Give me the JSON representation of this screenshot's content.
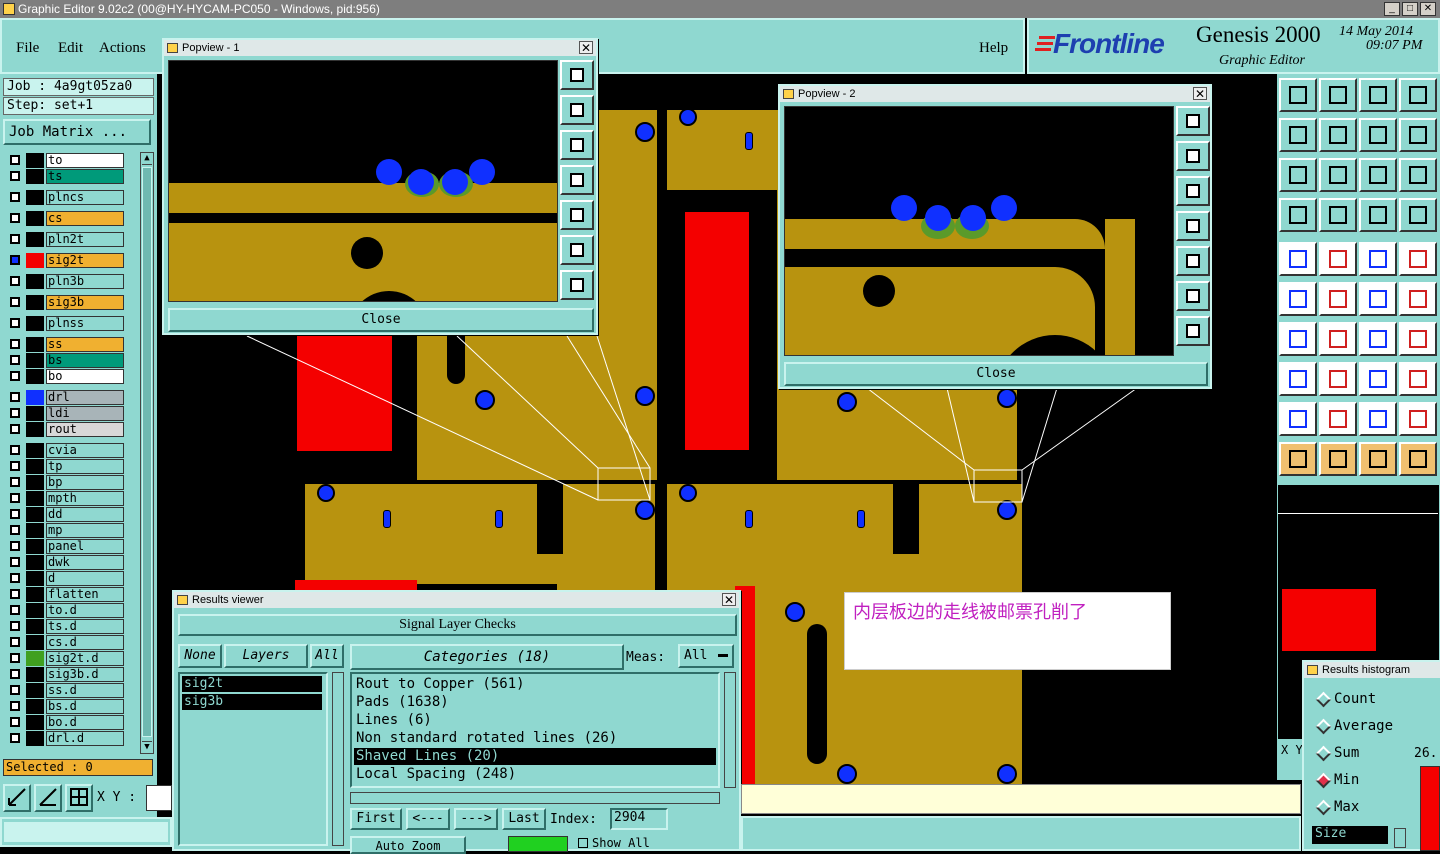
{
  "window": {
    "title": "Graphic Editor 9.02c2 (00@HY-HYCAM-PC050 - Windows, pid:956)"
  },
  "menu": {
    "file": "File",
    "edit": "Edit",
    "actions": "Actions",
    "help": "Help"
  },
  "brand": {
    "logo": "Frontline",
    "product": "Genesis 2000",
    "subtitle": "Graphic Editor",
    "date": "14 May 2014",
    "time": "09:07 PM"
  },
  "job": {
    "job_label": "Job : 4a9gt05za0",
    "step_label": "Step: set+1",
    "matrix_button": "Job Matrix ..."
  },
  "layers": [
    {
      "name": "to",
      "color": "#ffffff"
    },
    {
      "name": "ts",
      "color": "#009a7a"
    },
    {
      "name": "plncs",
      "color": "#8fd8d0"
    },
    {
      "name": "cs",
      "color": "#f0b030"
    },
    {
      "name": "pln2t",
      "color": "#8fd8d0"
    },
    {
      "name": "sig2t",
      "color": "#f0b030"
    },
    {
      "name": "pln3b",
      "color": "#8fd8d0"
    },
    {
      "name": "sig3b",
      "color": "#f0b030"
    },
    {
      "name": "plnss",
      "color": "#8fd8d0"
    },
    {
      "name": "ss",
      "color": "#f0b030"
    },
    {
      "name": "bs",
      "color": "#009a7a"
    },
    {
      "name": "bo",
      "color": "#ffffff"
    },
    {
      "name": "drl",
      "color": "#a8b4b8"
    },
    {
      "name": "ldi",
      "color": "#a8b4b8"
    },
    {
      "name": "rout",
      "color": "#d8d8d8"
    },
    {
      "name": "cvia",
      "color": "#8fd8d0"
    },
    {
      "name": "tp",
      "color": "#8fd8d0"
    },
    {
      "name": "bp",
      "color": "#8fd8d0"
    },
    {
      "name": "mpth",
      "color": "#8fd8d0"
    },
    {
      "name": "dd",
      "color": "#8fd8d0"
    },
    {
      "name": "mp",
      "color": "#8fd8d0"
    },
    {
      "name": "panel",
      "color": "#8fd8d0"
    },
    {
      "name": "dwk",
      "color": "#8fd8d0"
    },
    {
      "name": "d",
      "color": "#8fd8d0"
    },
    {
      "name": "flatten",
      "color": "#8fd8d0"
    },
    {
      "name": "to.d",
      "color": "#8fd8d0"
    },
    {
      "name": "ts.d",
      "color": "#8fd8d0"
    },
    {
      "name": "cs.d",
      "color": "#8fd8d0"
    },
    {
      "name": "sig2t.d",
      "color": "#8fd8d0"
    },
    {
      "name": "sig3b.d",
      "color": "#8fd8d0"
    },
    {
      "name": "ss.d",
      "color": "#8fd8d0"
    },
    {
      "name": "bs.d",
      "color": "#8fd8d0"
    },
    {
      "name": "bo.d",
      "color": "#8fd8d0"
    },
    {
      "name": "drl.d",
      "color": "#8fd8d0"
    }
  ],
  "selected": "Selected : 0",
  "xy_label": "X Y :",
  "popview1": {
    "title": "Popview - 1",
    "close": "Close"
  },
  "popview2": {
    "title": "Popview - 2",
    "close": "Close"
  },
  "annotation": "内层板边的走线被邮票孔削了",
  "results": {
    "title": "Results viewer",
    "header": "Signal Layer Checks",
    "none": "None",
    "layers_btn": "Layers",
    "all": "All",
    "categories_btn": "Categories (18)",
    "meas_label": "Meas:",
    "meas_value": "All",
    "layer_list": [
      "sig2t",
      "sig3b"
    ],
    "category_list": [
      "Rout to Copper (561)",
      "Pads (1638)",
      "Lines (6)",
      "Non standard rotated lines (26)",
      "Shaved Lines (20)",
      "Local Spacing (248)"
    ],
    "selected_category": "Shaved Lines (20)",
    "first": "First",
    "prev": "<---",
    "next": "--->",
    "last": "Last",
    "index_label": "Index:",
    "index_value": "2904",
    "auto_zoom": "Auto Zoom",
    "show_all": "Show All"
  },
  "histogram": {
    "title": "Results histogram",
    "options": [
      "Count",
      "Average",
      "Sum",
      "Min",
      "Max"
    ],
    "selected": "Min",
    "size_field": "Size",
    "value": "26."
  },
  "right_xy": "X Y"
}
